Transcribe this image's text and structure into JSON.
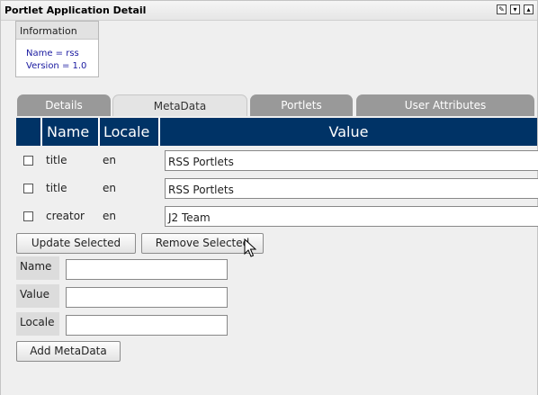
{
  "portlet": {
    "title": "Portlet Application Detail",
    "controls": {
      "edit": "✎",
      "minimize": "▾",
      "maximize": "▴"
    }
  },
  "info": {
    "header": "Information",
    "name_line": "Name = rss",
    "version_line": "Version = 1.0"
  },
  "tabs": [
    {
      "label": "Details",
      "active": false
    },
    {
      "label": "MetaData",
      "active": true
    },
    {
      "label": "Portlets",
      "active": false
    },
    {
      "label": "User Attributes",
      "active": false
    }
  ],
  "table": {
    "headers": {
      "select": "",
      "name": "Name",
      "locale": "Locale",
      "value": "Value"
    },
    "rows": [
      {
        "name": "title",
        "locale": "en",
        "value": "RSS Portlets"
      },
      {
        "name": "title",
        "locale": "en",
        "value": "RSS Portlets"
      },
      {
        "name": "creator",
        "locale": "en",
        "value": "J2 Team"
      }
    ]
  },
  "actions": {
    "update": "Update Selected",
    "remove": "Remove Selected"
  },
  "form": {
    "name_label": "Name",
    "value_label": "Value",
    "locale_label": "Locale",
    "name_value": "",
    "value_value": "",
    "locale_value": "",
    "add_button": "Add MetaData"
  },
  "colors": {
    "header_bg": "#003366",
    "tab_inactive": "#999999",
    "tab_active": "#e4e4e4",
    "content_bg": "#efefef",
    "info_text": "#1a1aa0"
  }
}
